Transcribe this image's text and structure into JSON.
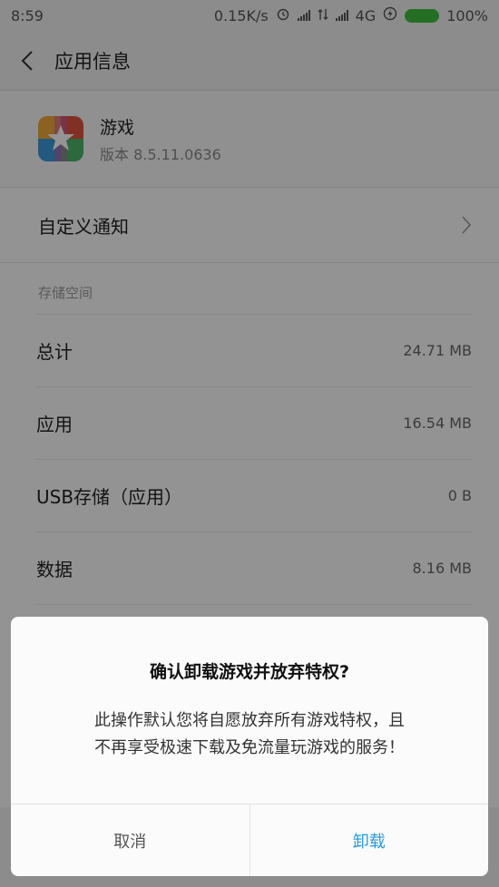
{
  "status_bar": {
    "time": "8:59",
    "net_speed": "0.15K/s",
    "network": "4G",
    "battery": "100%",
    "icons": [
      "alarm-icon",
      "signal-icon",
      "data-arrows-icon",
      "signal-icon",
      "charging-icon",
      "battery-icon"
    ]
  },
  "header": {
    "title": "应用信息"
  },
  "app": {
    "name": "游戏",
    "version": "版本 8.5.11.0636"
  },
  "notification": {
    "label": "自定义通知"
  },
  "storage": {
    "title": "存储空间",
    "rows": [
      {
        "label": "总计",
        "value": "24.71 MB"
      },
      {
        "label": "应用",
        "value": "16.54 MB"
      },
      {
        "label": "USB存储（应用）",
        "value": "0 B"
      },
      {
        "label": "数据",
        "value": "8.16 MB"
      }
    ]
  },
  "dialog": {
    "title": "确认卸载游戏并放弃特权?",
    "message_line1": "此操作默认您将自愿放弃所有游戏特权，且",
    "message_line2": "不再享受极速下载及免流量玩游戏的服务！",
    "cancel_label": "取消",
    "confirm_label": "卸载"
  },
  "colors": {
    "accent": "#2a9bd6",
    "battery": "#3fbf3f",
    "overlay": "rgba(0,0,0,0.42)"
  }
}
